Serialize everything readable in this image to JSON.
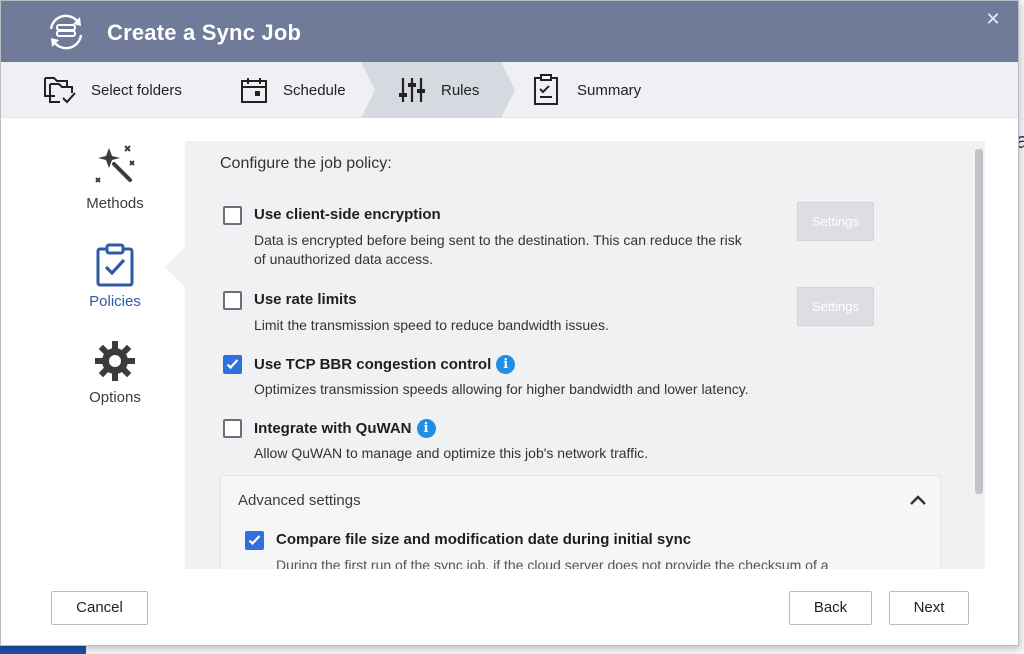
{
  "dialog": {
    "title": "Create a Sync Job",
    "close_icon": "close-icon"
  },
  "steps": [
    {
      "label": "Select folders",
      "icon": "folders-icon"
    },
    {
      "label": "Schedule",
      "icon": "calendar-icon"
    },
    {
      "label": "Rules",
      "icon": "sliders-icon",
      "active": true
    },
    {
      "label": "Summary",
      "icon": "clipboard-icon"
    }
  ],
  "nav": [
    {
      "label": "Methods",
      "icon": "magic-wand-icon"
    },
    {
      "label": "Policies",
      "icon": "clipboard-check-icon",
      "active": true
    },
    {
      "label": "Options",
      "icon": "gear-icon"
    }
  ],
  "panel": {
    "heading": "Configure the job policy:",
    "options": [
      {
        "title": "Use client-side encryption",
        "desc": "Data is encrypted before being sent to the destination. This can reduce the risk of unauthorized data access.",
        "checked": false,
        "settings_label": "Settings"
      },
      {
        "title": "Use rate limits",
        "desc": "Limit the transmission speed to reduce bandwidth issues.",
        "checked": false,
        "settings_label": "Settings"
      },
      {
        "title": "Use TCP BBR congestion control",
        "desc": "Optimizes transmission speeds allowing for higher bandwidth and lower latency.",
        "checked": true,
        "info": "i"
      },
      {
        "title": "Integrate with QuWAN",
        "desc": "Allow QuWAN to manage and optimize this job's network traffic.",
        "checked": false,
        "info": "i"
      }
    ],
    "advanced": {
      "title": "Advanced settings",
      "option": {
        "title": "Compare file size and modification date during initial sync",
        "desc": "During the first run of the sync job, if the cloud server does not provide the checksum of a",
        "checked": true
      }
    }
  },
  "footer": {
    "cancel_label": "Cancel",
    "back_label": "Back",
    "next_label": "Next"
  },
  "colors": {
    "titlebar": "#6f7b99",
    "accent": "#2f6fe0",
    "info": "#1f8fe6",
    "active_nav": "#2e5aa6"
  }
}
